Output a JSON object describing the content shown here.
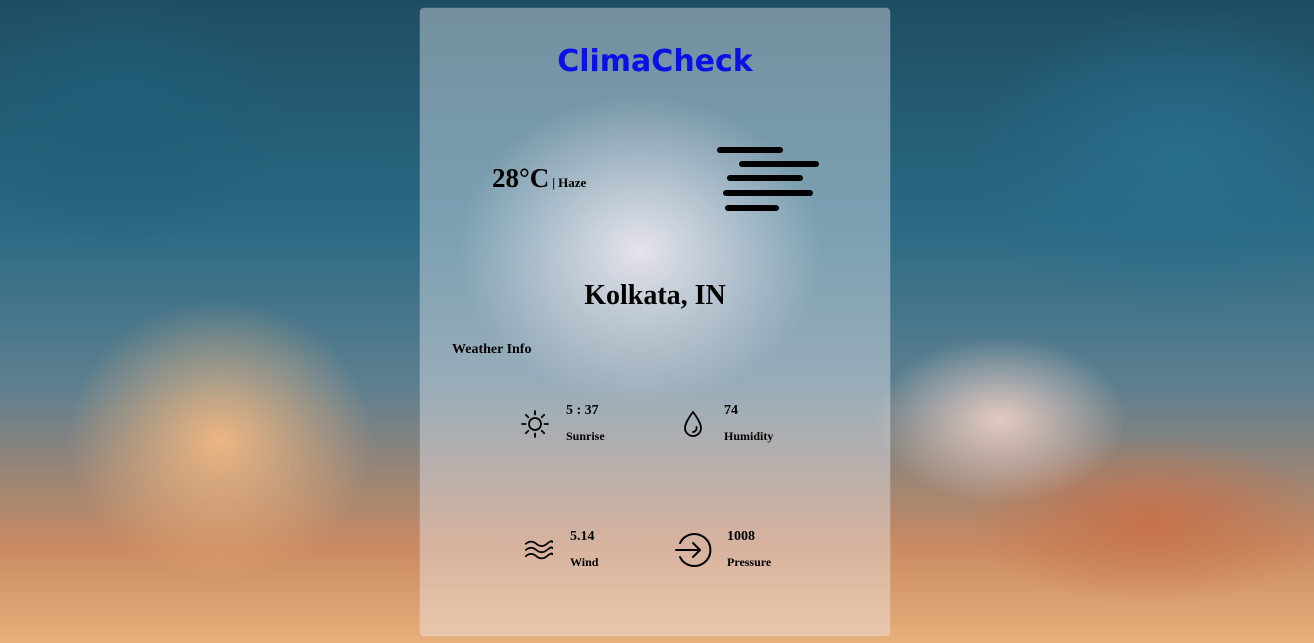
{
  "app": {
    "title": "ClimaCheck"
  },
  "current": {
    "temperature": "28°C",
    "separator": "|",
    "condition": "Haze",
    "condition_icon": "haze-icon"
  },
  "location": {
    "city": "Kolkata, IN"
  },
  "weather_info": {
    "heading": "Weather Info",
    "items": [
      {
        "icon": "sun-icon",
        "value": "5 : 37",
        "label": "Sunrise"
      },
      {
        "icon": "droplet-icon",
        "value": "74",
        "label": "Humidity"
      },
      {
        "icon": "wind-icon",
        "value": "5.14",
        "label": "Wind"
      },
      {
        "icon": "arrow-circle-icon",
        "value": "1008",
        "label": "Pressure"
      }
    ]
  },
  "colors": {
    "title": "#0a10e6",
    "text": "#000000"
  }
}
